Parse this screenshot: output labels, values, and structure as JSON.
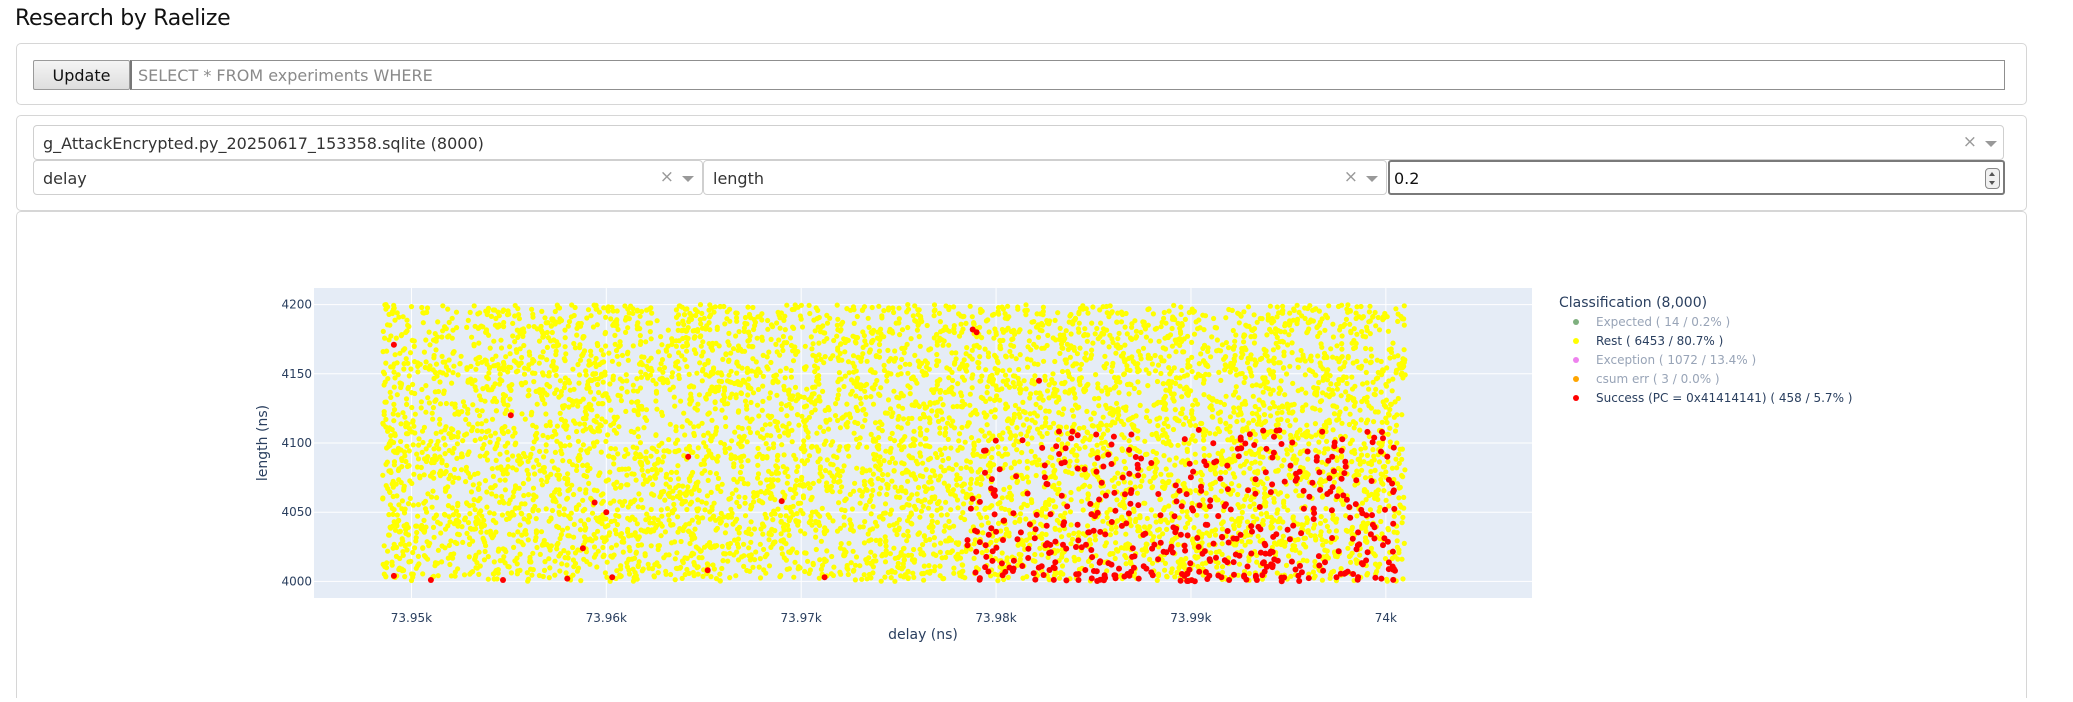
{
  "app": {
    "title": "Research by Raelize"
  },
  "query": {
    "button_label": "Update",
    "placeholder": "SELECT * FROM experiments WHERE"
  },
  "selectors": {
    "file": "g_AttackEncrypted.py_20250617_153358.sqlite (8000)",
    "x_field": "delay",
    "y_field": "length",
    "marker_value": "0.2",
    "clear_symbol": "×"
  },
  "chart_data": {
    "type": "scatter",
    "xlabel": "delay (ns)",
    "ylabel": "length (ns)",
    "xlim": [
      73.945,
      74.0075
    ],
    "ylim": [
      3988,
      4212
    ],
    "x_ticks": [
      73.95,
      73.96,
      73.97,
      73.98,
      73.99,
      74.0
    ],
    "x_tick_labels": [
      "73.95k",
      "73.96k",
      "73.97k",
      "73.98k",
      "73.99k",
      "74k"
    ],
    "y_ticks": [
      4000,
      4050,
      4100,
      4150,
      4200
    ],
    "y_tick_labels": [
      "4000",
      "4050",
      "4100",
      "4150",
      "4200"
    ],
    "grid": true,
    "background_color": "#e5ecf6",
    "legend": {
      "title": "Classification (8,000)",
      "placement": "right",
      "entries": [
        {
          "label": "Expected ( 14 / 0.2% )",
          "color": "#7fb07f",
          "dimmed": true
        },
        {
          "label": "Rest ( 6453 / 80.7% )",
          "color": "#ffff00",
          "dimmed": false
        },
        {
          "label": "Exception ( 1072 / 13.4% )",
          "color": "#ee82ee",
          "dimmed": true
        },
        {
          "label": "csum err ( 3 / 0.0% )",
          "color": "#ffa500",
          "dimmed": true
        },
        {
          "label": "Success (PC = 0x41414141) ( 458 / 5.7% )",
          "color": "#ff0000",
          "dimmed": false
        }
      ]
    },
    "series": [
      {
        "name": "Rest ( 6453 / 80.7% )",
        "color": "#ffff00",
        "count_shown": 6453,
        "x_range": [
          73.9485,
          74.001
        ],
        "y_range": [
          4000,
          4200
        ]
      },
      {
        "name": "Success (PC = 0x41414141) ( 458 / 5.7% )",
        "color": "#ff0000",
        "points": [
          [
            73.9491,
            4171
          ],
          [
            73.9551,
            4120
          ],
          [
            73.9594,
            4057
          ],
          [
            73.9588,
            4024
          ],
          [
            73.9652,
            4008
          ],
          [
            73.9642,
            4090
          ],
          [
            73.969,
            4058
          ],
          [
            73.96,
            4050
          ],
          [
            73.9822,
            4145
          ],
          [
            73.9788,
            4182
          ],
          [
            73.979,
            4180
          ],
          [
            73.9712,
            4003
          ],
          [
            73.9603,
            4003
          ],
          [
            73.9547,
            4001
          ],
          [
            73.9491,
            4004
          ],
          [
            73.951,
            4001
          ],
          [
            73.958,
            4002
          ]
        ],
        "dense_region": {
          "x": [
            73.9785,
            74.0005
          ],
          "y": [
            4000,
            4110
          ],
          "approx_points": 441
        }
      }
    ]
  }
}
